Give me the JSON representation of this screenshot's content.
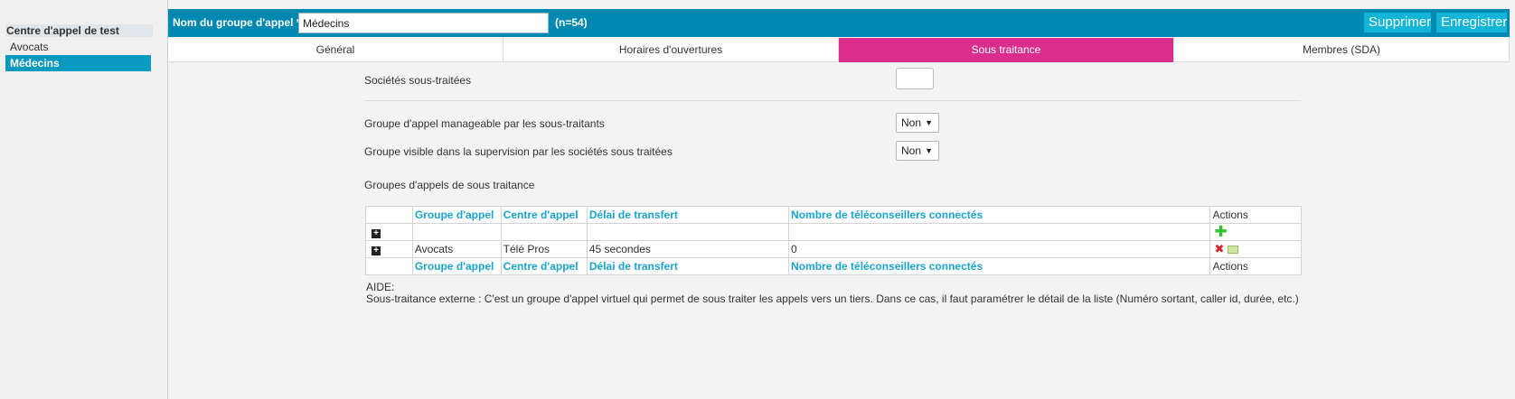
{
  "sidebar": {
    "group_title": "Centre d'appel de test",
    "items": [
      {
        "label": "Avocats"
      },
      {
        "label": "Médecins"
      }
    ]
  },
  "topbar": {
    "name_label": "Nom du groupe d'appel * :",
    "name_value": "Médecins",
    "count": "(n=54)",
    "delete_label": "Supprimer",
    "save_label": "Enregistrer"
  },
  "tabs": [
    {
      "label": "Général"
    },
    {
      "label": "Horaires d'ouvertures"
    },
    {
      "label": "Sous traitance",
      "active": true
    },
    {
      "label": "Membres (SDA)"
    }
  ],
  "form": {
    "subcontracted_label": "Sociétés sous-traitées",
    "manageable_label": "Groupe d'appel manageable par les sous-traitants",
    "manageable_value": "Non",
    "visible_label": "Groupe visible dans la supervision par les sociétés sous traitées",
    "visible_value": "Non",
    "groups_title": "Groupes d'appels de sous traitance"
  },
  "grid": {
    "headers": [
      "Groupe d'appel",
      "Centre d'appel",
      "Délai de transfert",
      "Nombre de téléconseillers connectés",
      "Actions"
    ],
    "rows": [
      {
        "group": "Avocats",
        "center": "Télé Pros",
        "delay": "45 secondes",
        "agents": "0"
      }
    ]
  },
  "help": {
    "title": "AIDE:",
    "text": "Sous-traitance externe : C'est un groupe d'appel virtuel qui permet de sous traiter les appels vers un tiers. Dans ce cas, il faut paramétrer le détail de la liste (Numéro sortant, caller id, durée, etc.)"
  },
  "colors": {
    "topbar": "#0089b0",
    "active_tab": "#db2d8e",
    "sidebar_selected": "#0a9ac0",
    "header_text": "#1aa3cf"
  }
}
